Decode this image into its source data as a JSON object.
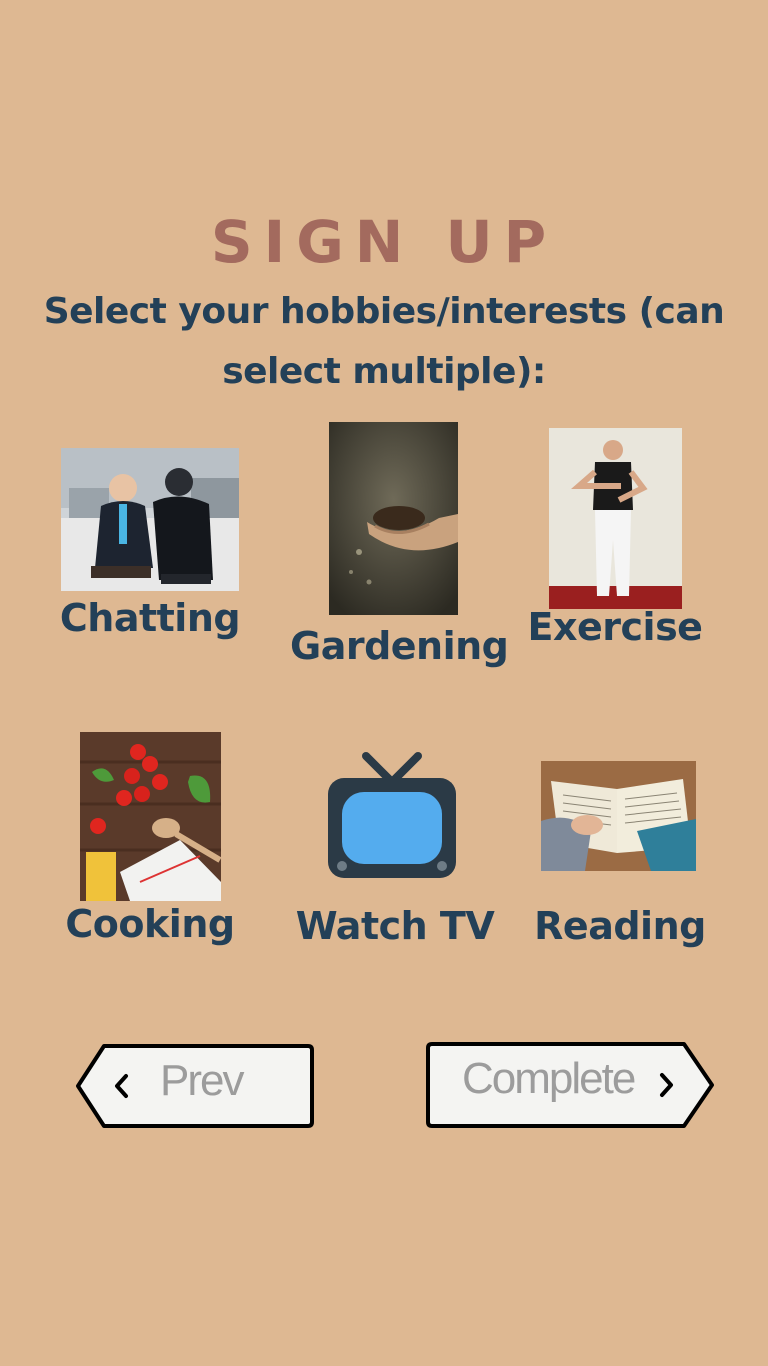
{
  "header": {
    "title": "SIGN UP",
    "prompt": "Select your hobbies/interests (can select multiple):"
  },
  "hobbies": [
    {
      "label": "Chatting",
      "icon": "people-chatting-photo"
    },
    {
      "label": "Gardening",
      "icon": "hands-holding-soil-photo"
    },
    {
      "label": "Exercise",
      "icon": "man-exercising-photo"
    },
    {
      "label": "Cooking",
      "icon": "tomatoes-and-pasta-photo"
    },
    {
      "label": "Watch TV",
      "icon": "tv-icon"
    },
    {
      "label": "Reading",
      "icon": "open-book-photo"
    }
  ],
  "nav": {
    "prev_label": "Prev",
    "complete_label": "Complete"
  },
  "colors": {
    "background": "#deb892",
    "title": "#a36a5e",
    "text": "#234058",
    "button_fill": "#f4f4f2",
    "button_text": "#9c9c9c",
    "tv_screen": "#54acee",
    "tv_body": "#2b3a46"
  }
}
